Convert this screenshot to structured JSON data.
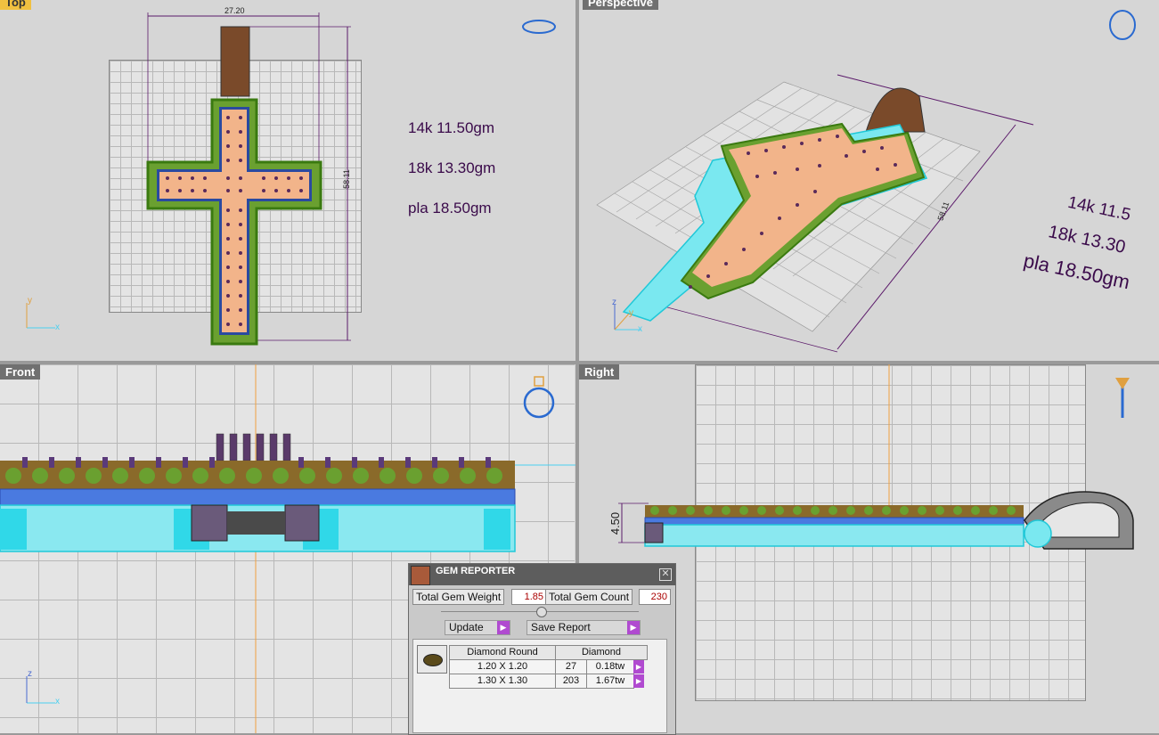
{
  "viewports": {
    "top": {
      "label": "Top"
    },
    "perspective": {
      "label": "Perspective"
    },
    "front": {
      "label": "Front"
    },
    "right": {
      "label": "Right"
    }
  },
  "weights": {
    "line1": "14k 11.50gm",
    "line2": "18k 13.30gm",
    "line3": "pla 18.50gm"
  },
  "perspective_weights": {
    "line1": "14k 11.5",
    "line2": "18k 13.30",
    "line3": "pla 18.50gm"
  },
  "dimensions": {
    "top_width": "27.20",
    "top_height": "58.11",
    "persp_height": "58.11",
    "right_thickness": "4.50"
  },
  "axes": {
    "x": "x",
    "y": "y",
    "z": "z"
  },
  "gem_reporter": {
    "title": "GEM REPORTER",
    "close": "✕",
    "total_weight_label": "Total Gem Weight",
    "total_weight_value": "1.85",
    "total_count_label": "Total Gem Count",
    "total_count_value": "230",
    "update_label": "Update",
    "save_label": "Save Report",
    "table": {
      "header_shape": "Diamond Round",
      "header_type": "Diamond",
      "rows": [
        {
          "size": "1.20 X 1.20",
          "count": "27",
          "weight": "0.18tw"
        },
        {
          "size": "1.30 X 1.30",
          "count": "203",
          "weight": "1.67tw"
        }
      ]
    }
  },
  "colors": {
    "gold": "#f2b48a",
    "cyan": "#20e8f0",
    "purple": "#5b1a6a",
    "accent": "#b04ad0"
  }
}
